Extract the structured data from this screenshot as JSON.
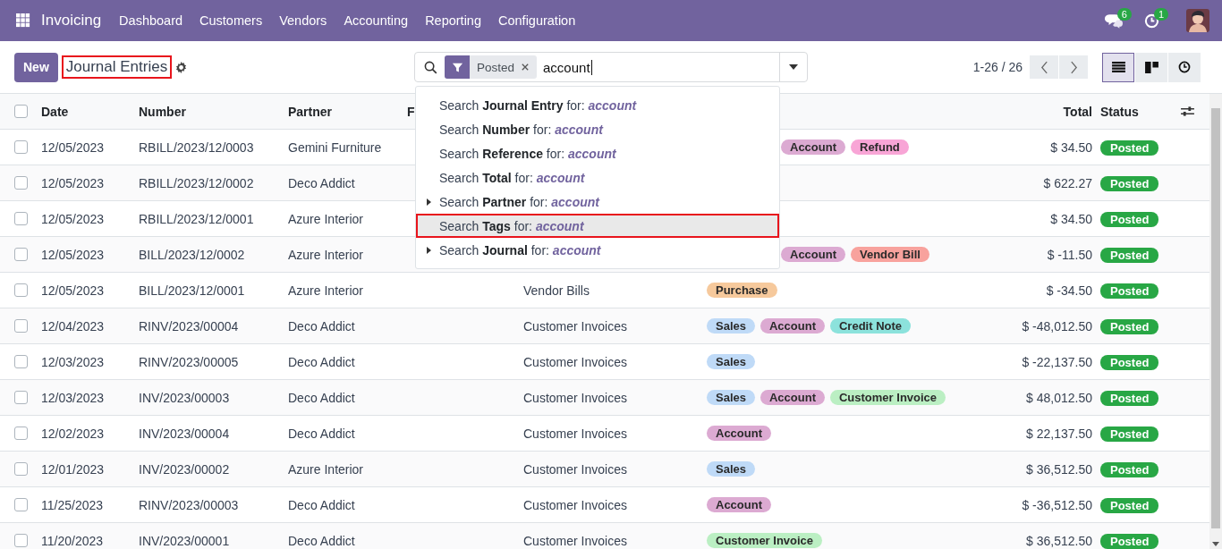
{
  "navbar": {
    "app_name": "Invoicing",
    "menu": [
      "Dashboard",
      "Customers",
      "Vendors",
      "Accounting",
      "Reporting",
      "Configuration"
    ],
    "messages_badge": "6",
    "activities_badge": "1"
  },
  "control_panel": {
    "new_button": "New",
    "title": "Journal Entries",
    "title_annotated": true,
    "search": {
      "facets": [
        {
          "label": "Posted"
        }
      ],
      "value": "account"
    },
    "pager": "1-26 / 26",
    "views": [
      {
        "kind": "list",
        "selected": true
      },
      {
        "kind": "kanban",
        "selected": false
      },
      {
        "kind": "activity",
        "selected": false
      }
    ]
  },
  "search_menu": {
    "items": [
      {
        "text": "Search **Journal Entry** for: *account*",
        "expandable": false,
        "selected": false,
        "annotated": false
      },
      {
        "text": "Search **Number** for: *account*",
        "expandable": false,
        "selected": false,
        "annotated": false
      },
      {
        "text": "Search **Reference** for: *account*",
        "expandable": false,
        "selected": false,
        "annotated": false
      },
      {
        "text": "Search **Total** for: *account*",
        "expandable": false,
        "selected": false,
        "annotated": false
      },
      {
        "text": "Search **Partner** for: *account*",
        "expandable": true,
        "selected": false,
        "annotated": false
      },
      {
        "text": "Search **Tags** for: *account*",
        "expandable": false,
        "selected": true,
        "annotated": true
      },
      {
        "text": "Search **Journal** for: *account*",
        "expandable": true,
        "selected": false,
        "annotated": false
      }
    ]
  },
  "table": {
    "select_all_checked": false,
    "columns": [
      "Date",
      "Number",
      "Partner",
      "F",
      "Total",
      "Status"
    ],
    "rows": [
      {
        "checked": false,
        "date": "12/05/2023",
        "number": "RBILL/2023/12/0003",
        "partner": "Gemini Furniture",
        "tags": [
          {
            "label": "Account",
            "color": "#dcaad2"
          },
          {
            "label": "Refund",
            "color": "#f8a5d6"
          }
        ],
        "total": "$ 34.50",
        "status": "Posted"
      },
      {
        "checked": false,
        "date": "12/05/2023",
        "number": "RBILL/2023/12/0002",
        "partner": "Deco Addict",
        "tags": [],
        "total": "$ 622.27",
        "status": "Posted"
      },
      {
        "checked": false,
        "date": "12/05/2023",
        "number": "RBILL/2023/12/0001",
        "partner": "Azure Interior",
        "tags": [],
        "total": "$ 34.50",
        "status": "Posted"
      },
      {
        "checked": false,
        "date": "12/05/2023",
        "number": "BILL/2023/12/0002",
        "partner": "Azure Interior",
        "tags": [
          {
            "label": "Account",
            "color": "#dcaad2"
          },
          {
            "label": "Vendor Bill",
            "color": "#f8a29d"
          }
        ],
        "total": "$ -11.50",
        "status": "Posted"
      },
      {
        "checked": false,
        "date": "12/05/2023",
        "number": "BILL/2023/12/0001",
        "partner": "Azure Interior",
        "journal": "Vendor Bills",
        "tags": [
          {
            "label": "Purchase",
            "color": "#f6c99c"
          }
        ],
        "total": "$ -34.50",
        "status": "Posted"
      },
      {
        "checked": false,
        "date": "12/04/2023",
        "number": "RINV/2023/00004",
        "partner": "Deco Addict",
        "journal": "Customer Invoices",
        "tags": [
          {
            "label": "Sales",
            "color": "#bfdaf7"
          },
          {
            "label": "Account",
            "color": "#dcaad2"
          },
          {
            "label": "Credit Note",
            "color": "#8ce2dc"
          }
        ],
        "total": "$ -48,012.50",
        "status": "Posted"
      },
      {
        "checked": false,
        "date": "12/03/2023",
        "number": "RINV/2023/00005",
        "partner": "Deco Addict",
        "journal": "Customer Invoices",
        "tags": [
          {
            "label": "Sales",
            "color": "#bfdaf7"
          }
        ],
        "total": "$ -22,137.50",
        "status": "Posted"
      },
      {
        "checked": false,
        "date": "12/03/2023",
        "number": "INV/2023/00003",
        "partner": "Deco Addict",
        "journal": "Customer Invoices",
        "tags": [
          {
            "label": "Sales",
            "color": "#bfdaf7"
          },
          {
            "label": "Account",
            "color": "#dcaad2"
          },
          {
            "label": "Customer Invoice",
            "color": "#bbefc3"
          }
        ],
        "total": "$ 48,012.50",
        "status": "Posted"
      },
      {
        "checked": false,
        "date": "12/02/2023",
        "number": "INV/2023/00004",
        "partner": "Deco Addict",
        "journal": "Customer Invoices",
        "tags": [
          {
            "label": "Account",
            "color": "#dcaad2"
          }
        ],
        "total": "$ 22,137.50",
        "status": "Posted"
      },
      {
        "checked": false,
        "date": "12/01/2023",
        "number": "INV/2023/00002",
        "partner": "Azure Interior",
        "journal": "Customer Invoices",
        "tags": [
          {
            "label": "Sales",
            "color": "#bfdaf7"
          }
        ],
        "total": "$ 36,512.50",
        "status": "Posted"
      },
      {
        "checked": false,
        "date": "11/25/2023",
        "number": "RINV/2023/00003",
        "partner": "Deco Addict",
        "journal": "Customer Invoices",
        "tags": [
          {
            "label": "Account",
            "color": "#dcaad2"
          }
        ],
        "total": "$ -36,512.50",
        "status": "Posted"
      },
      {
        "checked": false,
        "date": "11/20/2023",
        "number": "INV/2023/00001",
        "partner": "Deco Addict",
        "journal": "Customer Invoices",
        "tags": [
          {
            "label": "Customer Invoice",
            "color": "#bbefc3"
          }
        ],
        "total": "$ 36,512.50",
        "status": "Posted"
      }
    ]
  }
}
